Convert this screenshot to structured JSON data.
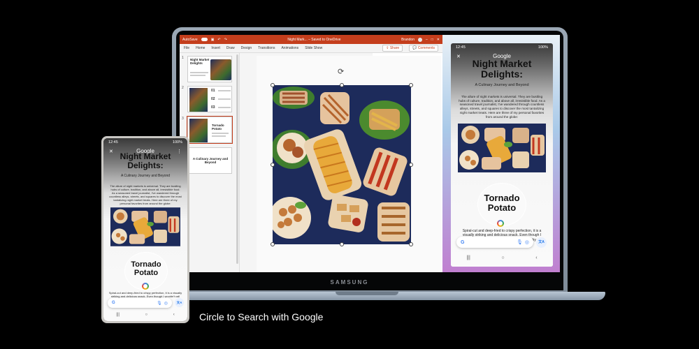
{
  "caption": "Circle to Search with Google",
  "laptop": {
    "brand": "SAMSUNG",
    "powerpoint": {
      "autosave_label": "AutoSave",
      "doc_title": "Night Mark... – Saved to OneDrive",
      "user": "Brandon",
      "ribbon_tabs": [
        "File",
        "Home",
        "Insert",
        "Draw",
        "Design",
        "Transitions",
        "Animations",
        "Slide Show"
      ],
      "share_label": "Share",
      "comments_label": "Comments",
      "slides": [
        {
          "num": "1",
          "title": "Night Market Delights"
        },
        {
          "num": "2",
          "items": [
            "01",
            "02",
            "03"
          ]
        },
        {
          "num": "3",
          "title": "Tornado Potato"
        },
        {
          "num": "4",
          "title": "A Culinary Journey and Beyond"
        }
      ],
      "accent": "#c43e1c"
    }
  },
  "phone": {
    "time": "12:45",
    "battery": "100%",
    "google_label": "Google",
    "title_line1": "Night Market",
    "title_line2": "Delights:",
    "subtitle": "A Culinary Journey and Beyond",
    "paragraph": "The allure of night markets is universal. They are bustling hubs of culture, tradition, and above all, irresistible food. As a seasoned travel journalist, I've wandered through countless alleys, streets, and squares to discover the most tantalizing night market treats. Here are three of my personal favorites from around the globe:",
    "circled_line1": "Tornado",
    "circled_line2": "Potato",
    "description": "Spiral-cut and deep-fried to crispy perfection, it is a visually striking and delicious snack. Even though I wouldn't call myself a foodie, I could walk by",
    "description_short": "Spiral-cut and deep-fried to crispy perfection, it is a visually striking and delicious snack. Even though I wouldn't call myself a foodie, I could walk",
    "search_G": "G",
    "translate_glyph": "文A",
    "nav": [
      "|||",
      "○",
      "‹"
    ]
  }
}
